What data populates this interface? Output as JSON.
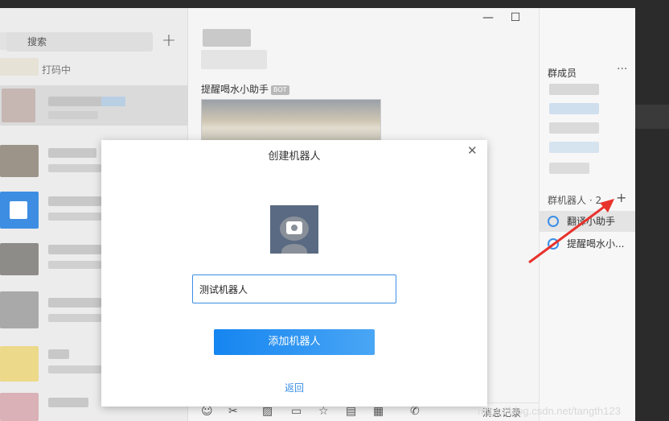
{
  "sidebar": {
    "search_label": "搜索",
    "add_label": "+",
    "typing_status": "打码中"
  },
  "chat": {
    "window_controls": [
      "—",
      "☐",
      "✕"
    ],
    "bot_sender": "提醒喝水小助手",
    "bot_badge": "BOT",
    "toolbar_history": "消息记录"
  },
  "group_panel": {
    "members_title": "群成员",
    "more": "···",
    "robots_title": "群机器人 · 2",
    "robots_add": "+",
    "robots": [
      {
        "name": "翻译小助手"
      },
      {
        "name": "提醒喝水小..."
      }
    ]
  },
  "dialog": {
    "title": "创建机器人",
    "close": "✕",
    "name_value": "测试机器人",
    "add_button": "添加机器人",
    "back_link": "返回"
  },
  "watermark": "https://blog.csdn.net/tangth123",
  "colors": {
    "accent": "#1585f0",
    "arrow": "#e8322c"
  }
}
